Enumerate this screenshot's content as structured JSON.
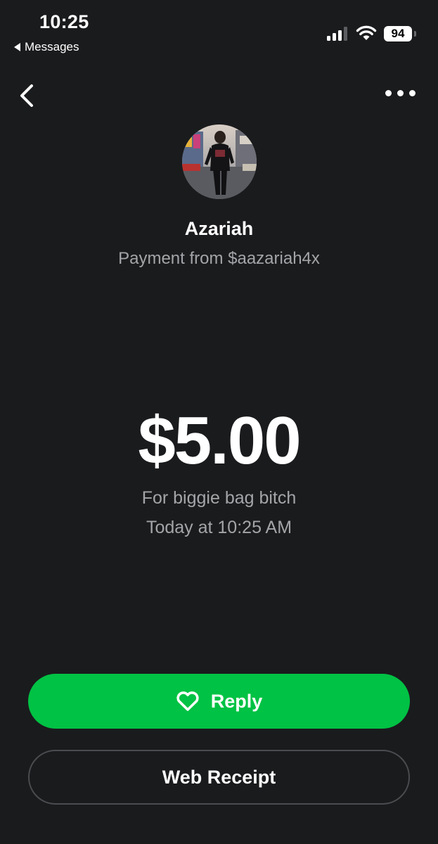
{
  "status_bar": {
    "time": "10:25",
    "back_app_label": "Messages",
    "battery": "94",
    "signal_icon": "cellular-signal-icon",
    "wifi_icon": "wifi-icon"
  },
  "nav": {
    "back_icon": "chevron-left-icon",
    "more_icon": "more-horizontal-icon"
  },
  "sender": {
    "name": "Azariah",
    "subtitle": "Payment from $aazariah4x"
  },
  "payment": {
    "amount": "$5.00",
    "note": "For biggie bag bitch",
    "timestamp": "Today at 10:25 AM"
  },
  "actions": {
    "reply_label": "Reply",
    "reply_icon": "heart-outline-icon",
    "receipt_label": "Web Receipt"
  },
  "colors": {
    "background": "#1a1b1d",
    "accent_green": "#00c244",
    "secondary_text": "#a4a5a8",
    "button_border": "#4b4c4f"
  }
}
